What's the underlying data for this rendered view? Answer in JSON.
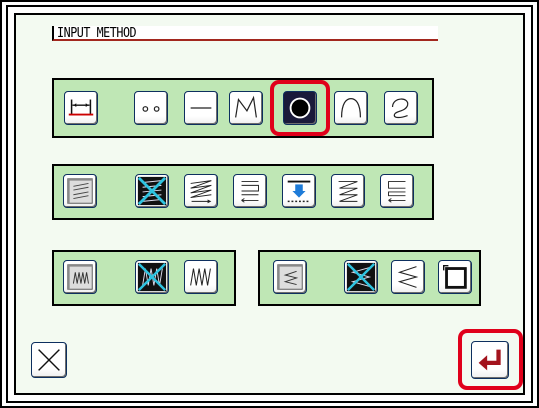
{
  "title": "INPUT METHOD",
  "colors": {
    "panel_bg": "#bfe7b5",
    "screen_bg": "#f3faf1",
    "highlight": "#e0001b",
    "button_border": "#0d2f5f"
  },
  "row1": {
    "buttons": [
      "interval-icon",
      "dots-icon",
      "straight-line-icon",
      "polyline-icon",
      "circle-icon",
      "arc-icon",
      "curve-icon"
    ],
    "selected": "circle-icon"
  },
  "row2": {
    "buttons": [
      "fill-stitch-icon",
      "fill-stitch-cancel-icon",
      "zigzag-fill-icon",
      "return-fill-icon",
      "down-feed-icon",
      "diagonal-fill-icon",
      "reverse-return-icon"
    ]
  },
  "row3a": {
    "buttons": [
      "zigzag-pattern-icon",
      "zigzag-cancel-icon",
      "zigzag-stitch-icon"
    ]
  },
  "row3b": {
    "buttons": [
      "satin-pattern-icon",
      "satin-cancel-icon",
      "satin-stitch-icon",
      "square-frame-icon"
    ]
  },
  "footer": {
    "cancel": "close-icon",
    "confirm": "enter-icon"
  }
}
